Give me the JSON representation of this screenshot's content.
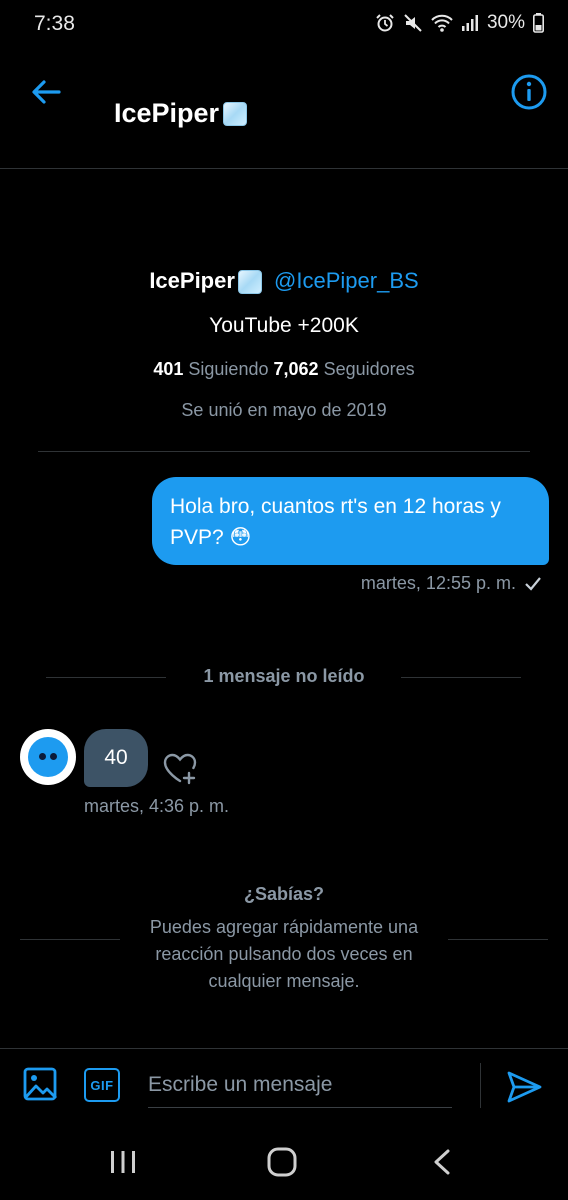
{
  "status_bar": {
    "time": "7:38",
    "battery": "30%",
    "icons": [
      "alarm-icon",
      "mute-icon",
      "wifi-icon",
      "signal-icon",
      "battery-icon"
    ]
  },
  "header": {
    "title": "IcePiper",
    "title_emoji": "ice-cube-icon"
  },
  "profile": {
    "name": "IcePiper",
    "handle": "@IcePiper_BS",
    "bio": "YouTube +200K",
    "following_count": "401",
    "following_label": "Siguiendo",
    "followers_count": "7,062",
    "followers_label": "Seguidores",
    "joined": "Se unió en mayo de 2019"
  },
  "messages": {
    "sent_text": "Hola bro, cuantos rt's en 12 horas y PVP? 😳",
    "sent_time": "martes, 12:55 p. m.",
    "unread_label": "1 mensaje no leído",
    "received_text": "40",
    "received_time": "martes, 4:36 p. m."
  },
  "tip": {
    "title": "¿Sabías?",
    "body": "Puedes agregar rápidamente una reacción pulsando dos veces en cualquier mensaje."
  },
  "composer": {
    "placeholder": "Escribe un mensaje",
    "gif_label": "GIF"
  },
  "colors": {
    "accent": "#1d9bf0",
    "background": "#000000",
    "muted_text": "#8b98a5",
    "received_bubble": "#3d5366"
  }
}
